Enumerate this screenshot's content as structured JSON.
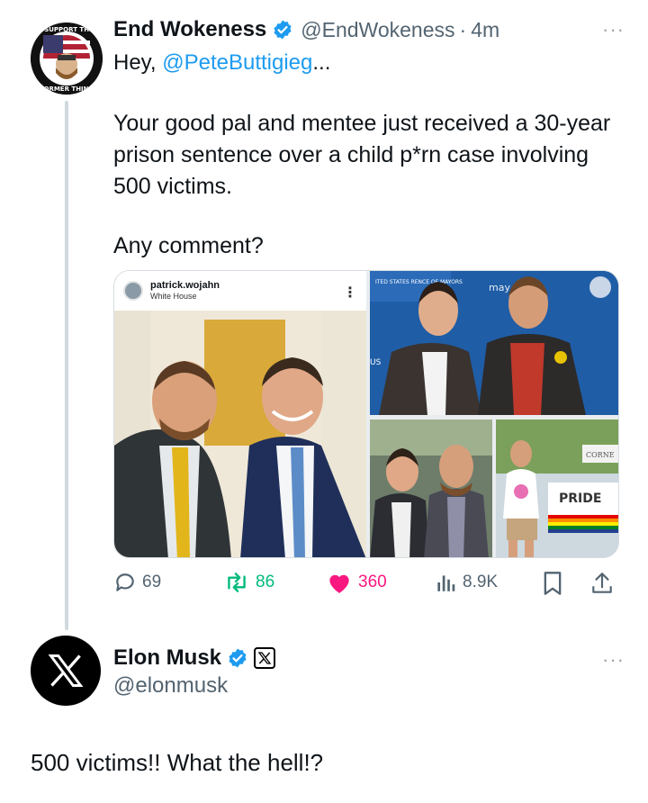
{
  "tweet": {
    "display_name": "End Wokeness",
    "handle": "@EndWokeness",
    "separator": "·",
    "time": "4m",
    "more_label": "···",
    "greeting_prefix": "Hey, ",
    "greeting_mention": "@PeteButtigieg",
    "greeting_suffix": "...",
    "body": "Your good pal and mentee just received a 30-year prison sentence over a child p*rn case involving 500 victims.",
    "question": "Any comment?",
    "avatar_text_top": "I SUPPORT THE",
    "avatar_text_bottom": "FORMER THING",
    "media": {
      "ig_username": "patrick.wojahn",
      "ig_location": "White House",
      "ig_more": "⋮",
      "banner_text": "ITED STATES RENCE OF MAYORS",
      "banner_small": "may",
      "banner_side": "US",
      "pride_sign": "PRIDE",
      "corner_sign": "CORNE"
    },
    "stats": {
      "replies": "69",
      "retweets": "86",
      "likes": "360",
      "views": "8.9K"
    }
  },
  "reply": {
    "display_name": "Elon Musk",
    "handle": "@elonmusk",
    "more_label": "···",
    "text": "500 victims!! What the hell!?"
  },
  "colors": {
    "accent": "#1d9bf0",
    "retweet": "#00ba7c",
    "like": "#f91880",
    "muted": "#536471"
  }
}
